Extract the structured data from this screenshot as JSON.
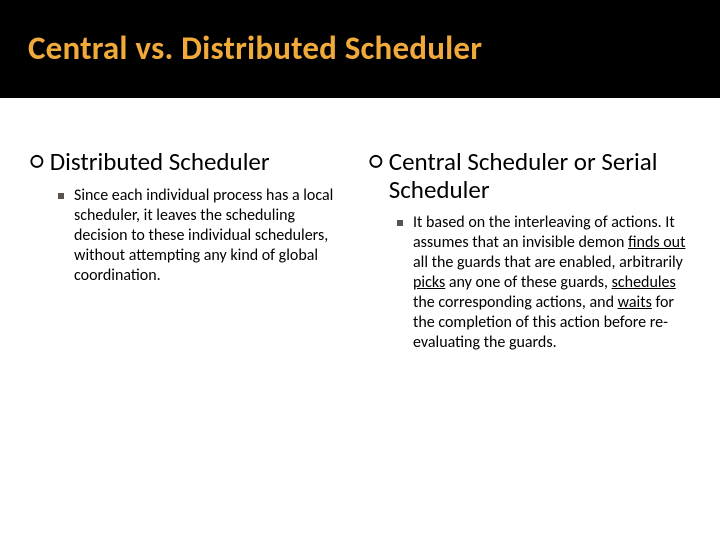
{
  "title": "Central vs. Distributed Scheduler",
  "left": {
    "heading": "Distributed Scheduler",
    "body_pre": "Since each individual process has a local scheduler, it leaves the scheduling decision to these individual schedulers, without attempting any kind of global coordination."
  },
  "right": {
    "heading": "Central Scheduler or Serial Scheduler",
    "body": {
      "p1": "It based on the interleaving of actions. It assumes that an invisible demon ",
      "u1": "finds out",
      "p2": " all the guards that are enabled, arbitrarily ",
      "u2": "picks",
      "p3": " any one of these guards, ",
      "u3": "schedules",
      "p4": " the corresponding actions, and ",
      "u4": "waits",
      "p5": " for the completion of this action before re-evaluating the guards."
    }
  }
}
